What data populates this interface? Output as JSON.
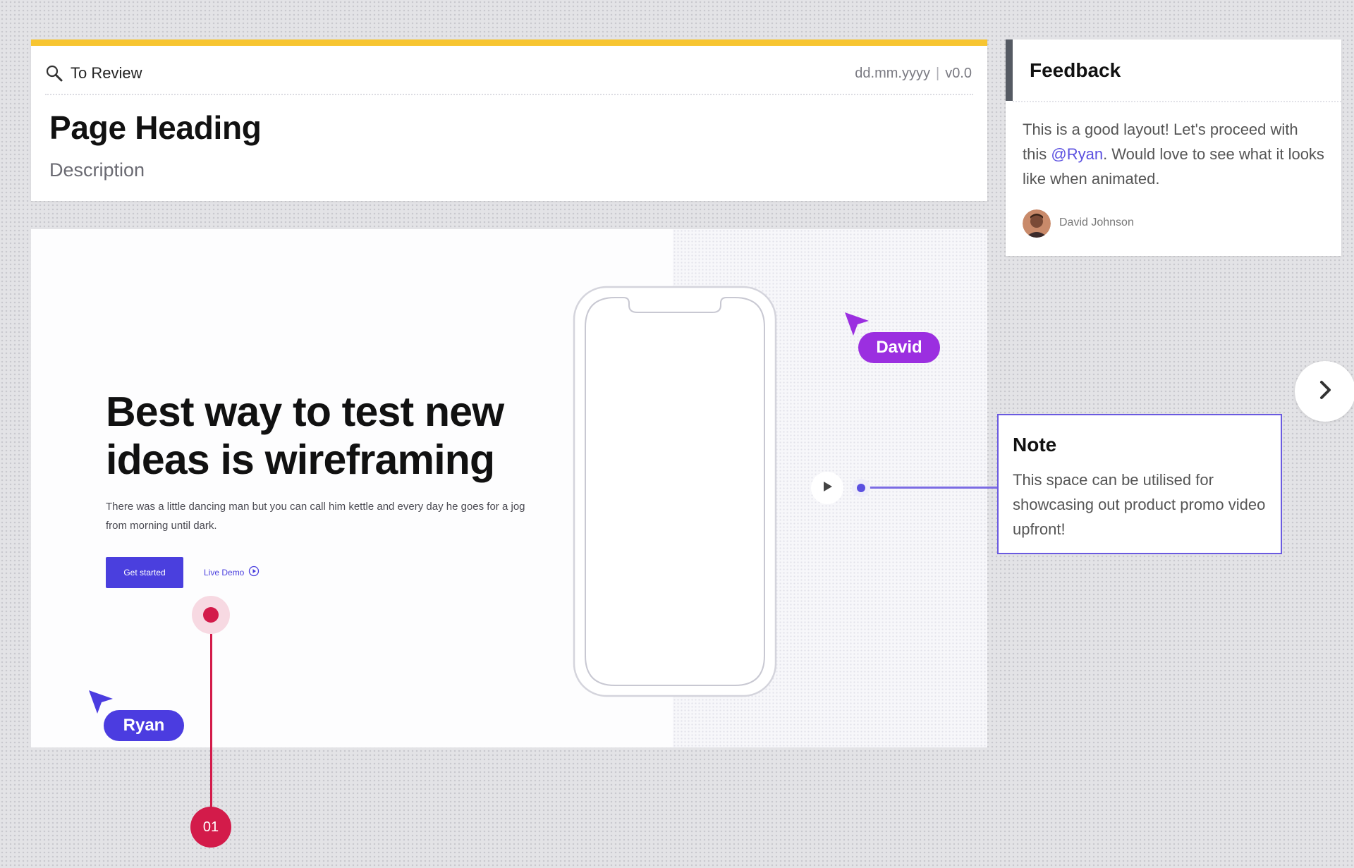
{
  "header": {
    "status_label": "To Review",
    "date": "dd.mm.yyyy",
    "separator": "|",
    "version": "v0.0",
    "title": "Page Heading",
    "description": "Description"
  },
  "hero": {
    "heading": "Best way to test new ideas is wireframing",
    "text": "There was a little dancing man but you can call him kettle and every day he goes for a jog from morning until dark.",
    "cta_label": "Get started",
    "demo_label": "Live Demo"
  },
  "cursors": {
    "david": "David",
    "ryan": "Ryan"
  },
  "feedback": {
    "title": "Feedback",
    "text_before": "This is a good layout! Let's proceed with this ",
    "mention": "@Ryan",
    "text_after": ". Would love to see what it looks like when animated.",
    "author": "David Johnson"
  },
  "note": {
    "title": "Note",
    "text": "This space can be utilised for showcasing out product promo video upfront!"
  },
  "hotspot": {
    "label": "01"
  },
  "colors": {
    "accent_yellow": "#f7c531",
    "brand_blue": "#4a3fde",
    "david_purple": "#9b2fe0",
    "ryan_blue": "#4b3ce0",
    "hotspot_red": "#d31b4a",
    "note_border": "#6a5ae0"
  },
  "icons": {
    "status": "search-icon",
    "demo": "play-circle-icon",
    "play": "play-icon",
    "next": "chevron-right-icon",
    "cursor": "cursor-arrow-icon"
  }
}
